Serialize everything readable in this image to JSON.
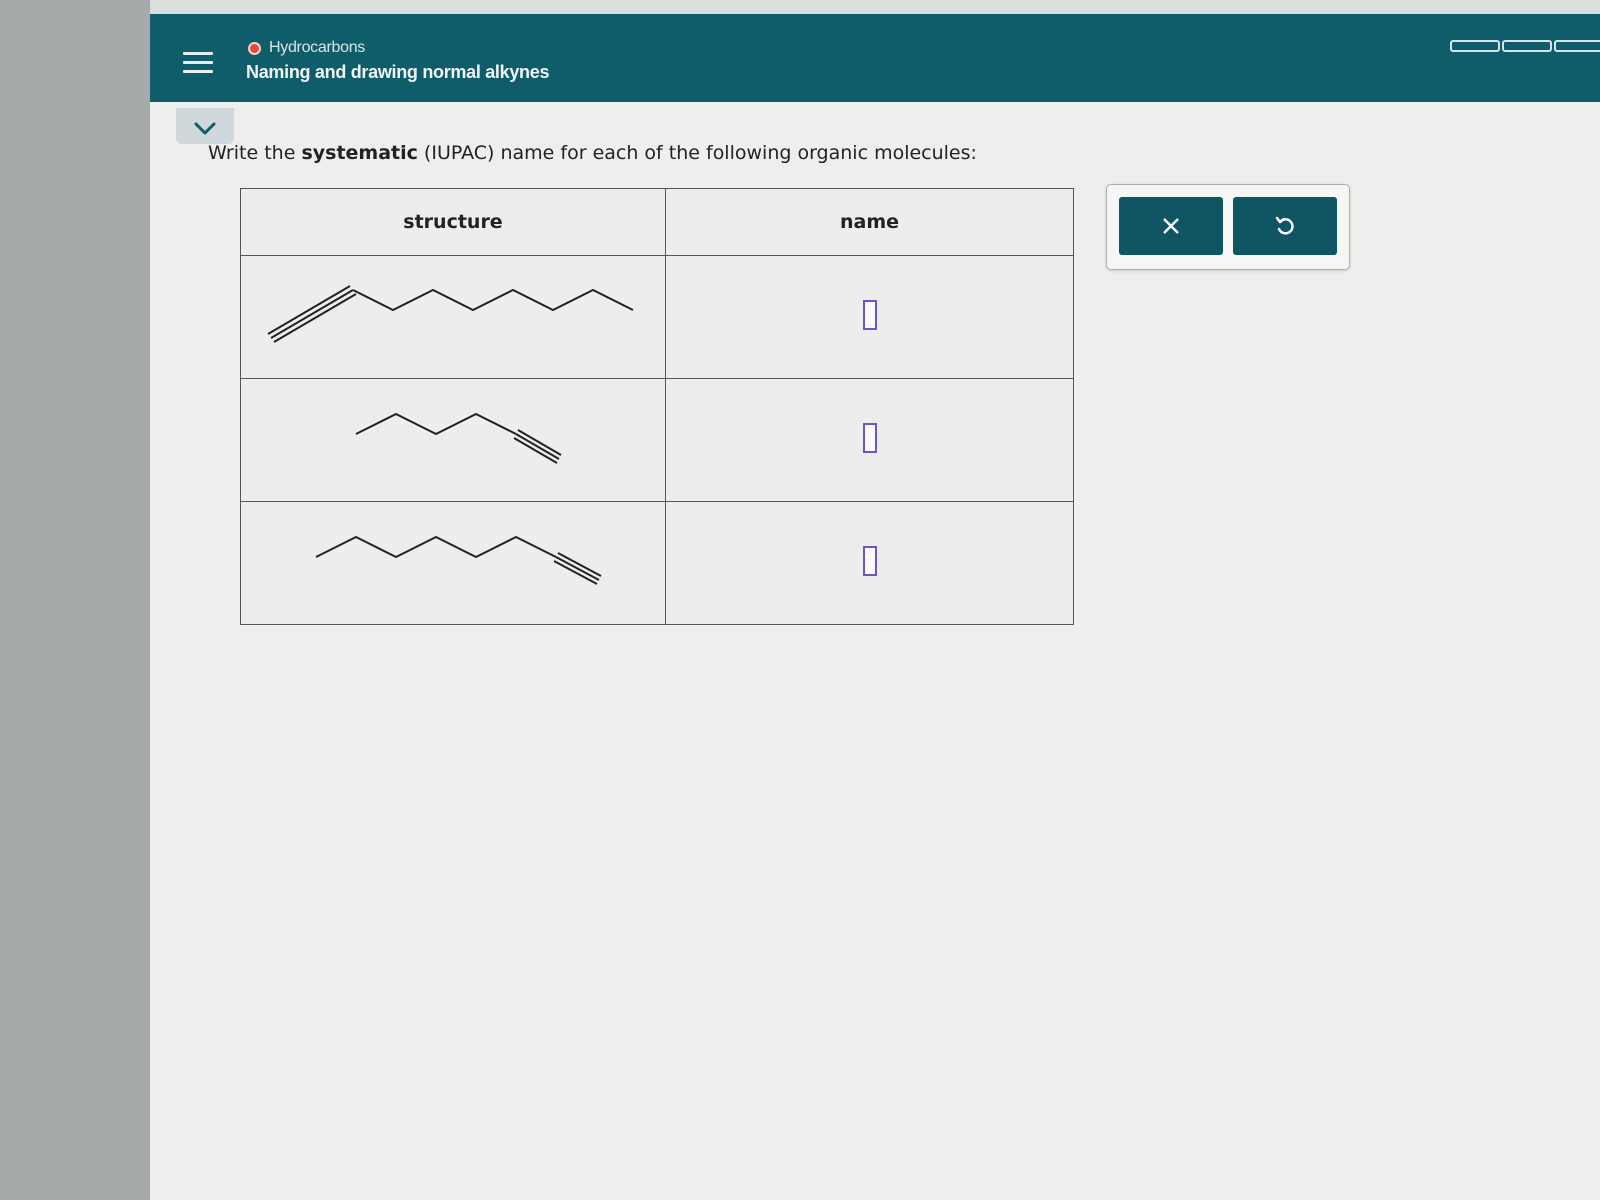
{
  "header": {
    "topic": "Hydrocarbons",
    "title": "Naming and drawing normal alkynes",
    "progress_segments": 3
  },
  "question": {
    "prefix": "Write the ",
    "emphasis": "systematic",
    "suffix": " (IUPAC) name for each of the following organic molecules:"
  },
  "table": {
    "headers": {
      "structure": "structure",
      "name": "name"
    },
    "rows": [
      {
        "structure_icon": "alkyne-skeletal-structure-1",
        "answer": ""
      },
      {
        "structure_icon": "alkyne-skeletal-structure-2",
        "answer": ""
      },
      {
        "structure_icon": "alkyne-skeletal-structure-3",
        "answer": ""
      }
    ]
  },
  "actions": {
    "clear_icon": "x-icon",
    "undo_icon": "undo-icon"
  },
  "colors": {
    "header": "#0f5d6b",
    "button": "#0f5563",
    "topic_dot": "#e14b3b",
    "answer_border": "#6a56c8"
  }
}
